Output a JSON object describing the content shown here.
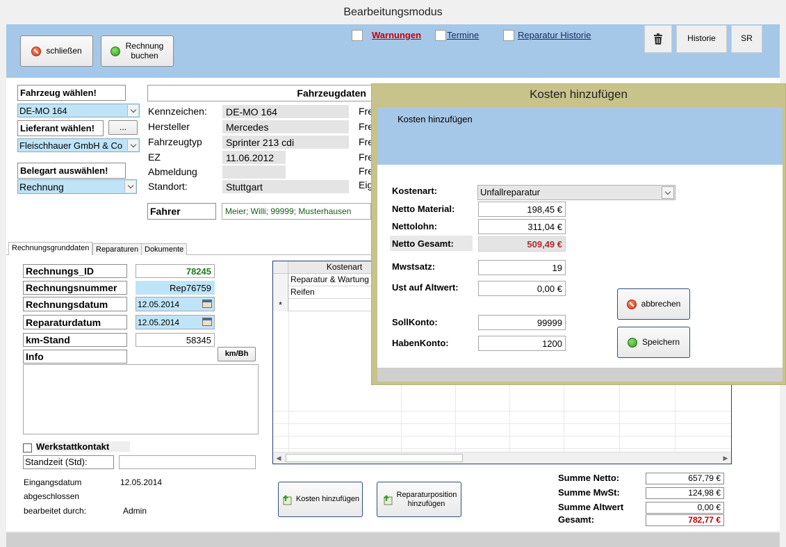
{
  "window": {
    "title": "Bearbeitungsmodus"
  },
  "toolbar": {
    "close_label": "schließen",
    "book_label": "Rechnung buchen",
    "warnings_label": "Warnungen",
    "appointments_label": "Termine",
    "repair_history_label": "Reparatur Historie",
    "history_label": "Historie",
    "sr_label": "SR"
  },
  "vehicle": {
    "choose_vehicle_label": "Fahrzeug wählen!",
    "vehicle_value": "DE-MO 164",
    "choose_supplier_label": "Lieferant wählen!",
    "supplier_more": "...",
    "supplier_value": "Fleischhauer GmbH & Co",
    "choose_doctype_label": "Belegart auswählen!",
    "doctype_value": "Rechnung",
    "data_header": "Fahrzeugdaten",
    "plate_label": "Kennzeichen:",
    "plate_value": "DE-MO 164",
    "make_label": "Hersteller",
    "make_value": "Mercedes",
    "type_label": "Fahrzeugtyp",
    "type_value": "Sprinter 213 cdi",
    "ez_label": "EZ",
    "ez_value": "11.06.2012",
    "dereg_label": "Abmeldung",
    "dereg_value": "",
    "location_label": "Standort:",
    "location_value": "Stuttgart",
    "driver_label": "Fahrer",
    "driver_value": "Meier; Willi; 99999; Musterhausen",
    "side_labels": [
      "Fre",
      "Fre",
      "Fre",
      "Fre",
      "Fre",
      "Eig"
    ]
  },
  "tabs": {
    "items": [
      "Rechnungsgrunddaten",
      "Reparaturen",
      "Dokumente"
    ]
  },
  "invoice": {
    "id_label": "Rechnungs_ID",
    "id_value": "78245",
    "number_label": "Rechnungsnummer",
    "number_value": "Rep76759",
    "date_label": "Rechnungsdatum",
    "date_value": "12.05.2014",
    "repair_date_label": "Reparaturdatum",
    "repair_date_value": "12.05.2014",
    "km_label": "km-Stand",
    "km_value": "58345",
    "info_label": "Info",
    "kmbh_label": "km/Bh",
    "contact_label": "Werkstattkontakt",
    "standtime_label": "Standzeit (Std):",
    "received_label": "Eingangsdatum",
    "received_value": "12.05.2014",
    "closed_label": "abgeschlossen",
    "editor_label": "bearbeitet durch:",
    "editor_value": "Admin"
  },
  "grid": {
    "header": "Kostenart",
    "rows": [
      "Reparatur & Wartung",
      "Reifen"
    ],
    "new_row_marker": "*"
  },
  "actions": {
    "add_costs_label": "Kosten hinzufügen",
    "add_position_label": "Reparaturposition hinzufügen"
  },
  "totals": {
    "net_label": "Summe Netto:",
    "net_value": "657,79 €",
    "vat_label": "Summe MwSt:",
    "vat_value": "124,98 €",
    "old_value_label": "Summe Altwert",
    "old_value_value": "0,00 €",
    "total_label": "Gesamt:",
    "total_value": "782,77 €"
  },
  "dialog": {
    "title": "Kosten hinzufügen",
    "subtitle": "Kosten hinzufügen",
    "cost_type_label": "Kostenart:",
    "cost_type_value": "Unfallreparatur",
    "net_material_label": "Netto Material:",
    "net_material_value": "198,45 €",
    "net_wage_label": "Nettolohn:",
    "net_wage_value": "311,04 €",
    "net_total_label": "Netto Gesamt:",
    "net_total_value": "509,49 €",
    "vat_rate_label": "Mwstsatz:",
    "vat_rate_value": "19",
    "vat_old_label": "Ust auf Altwert:",
    "vat_old_value": "0,00 €",
    "debit_label": "SollKonto:",
    "debit_value": "99999",
    "credit_label": "HabenKonto:",
    "credit_value": "1200",
    "cancel_label": "abbrechen",
    "save_label": "Speichern"
  },
  "colors": {
    "accent_red": "#c00000",
    "id_green": "#1d7a1d",
    "header_blue": "#a6c8e8",
    "dialog_olive": "#c8c38b"
  }
}
